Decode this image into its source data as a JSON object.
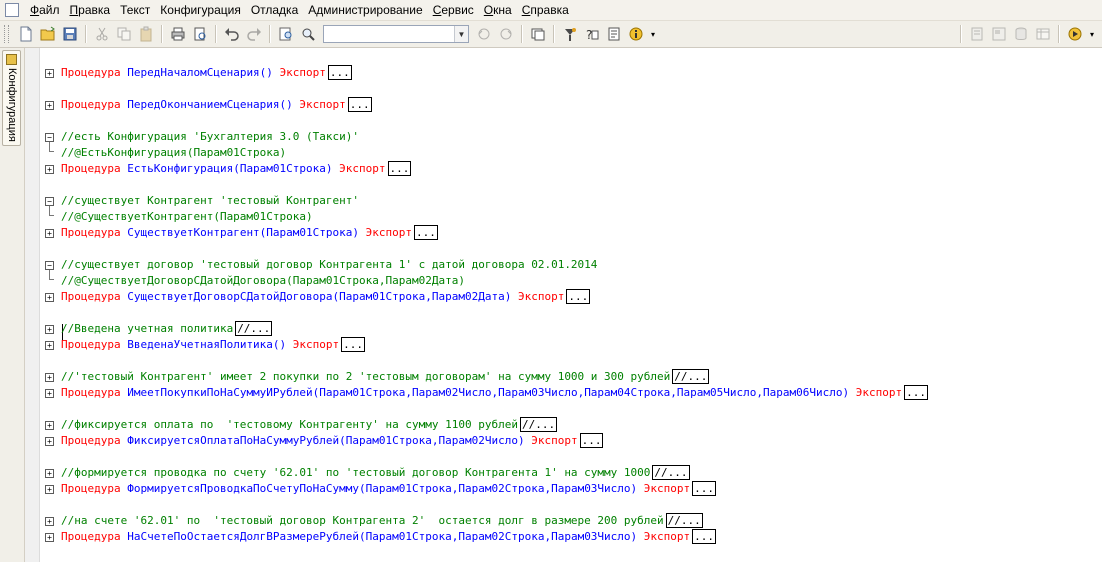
{
  "menu": [
    "Файл",
    "Правка",
    "Текст",
    "Конфигурация",
    "Отладка",
    "Администрирование",
    "Сервис",
    "Окна",
    "Справка"
  ],
  "menu_underline": [
    "Ф",
    "П",
    "",
    "",
    "",
    "",
    "С",
    "О",
    "С"
  ],
  "search": {
    "value": ""
  },
  "sidebar": {
    "tab_label": "Конфигурация"
  },
  "editor": {
    "ellipsis": "...",
    "comment_ellipsis": "//...",
    "lines": [
      {
        "kind": "proc",
        "fold": "plus",
        "keyword": "Процедура",
        "name": "ПередНачаломСценария()",
        "export": "Экспорт"
      },
      {
        "kind": "blank"
      },
      {
        "kind": "proc",
        "fold": "plus",
        "keyword": "Процедура",
        "name": "ПередОкончаниемСценария()",
        "export": "Экспорт"
      },
      {
        "kind": "blank"
      },
      {
        "kind": "comment",
        "fold": "minus",
        "text": "//есть Конфигурация 'Бухгалтерия 3.0 (Такси)'"
      },
      {
        "kind": "comment",
        "fold": "branch",
        "text": "//@ЕстьКонфигурация(Парам01Строка)"
      },
      {
        "kind": "proc",
        "fold": "plus",
        "keyword": "Процедура",
        "name": "ЕстьКонфигурация(Парам01Строка)",
        "export": "Экспорт"
      },
      {
        "kind": "blank"
      },
      {
        "kind": "comment",
        "fold": "minus",
        "text": "//существует Контрагент 'тестовый Контрагент'"
      },
      {
        "kind": "comment",
        "fold": "branch",
        "text": "//@СуществуетКонтрагент(Парам01Строка)"
      },
      {
        "kind": "proc",
        "fold": "plus",
        "keyword": "Процедура",
        "name": "СуществуетКонтрагент(Парам01Строка)",
        "export": "Экспорт"
      },
      {
        "kind": "blank"
      },
      {
        "kind": "comment",
        "fold": "minus",
        "text": "//существует договор 'тестовый договор Контрагента 1' с датой договора 02.01.2014"
      },
      {
        "kind": "comment",
        "fold": "branch",
        "text": "//@СуществуетДоговорСДатойДоговора(Парам01Строка,Парам02Дата)"
      },
      {
        "kind": "proc",
        "fold": "plus",
        "keyword": "Процедура",
        "name": "СуществуетДоговорСДатойДоговора(Парам01Строка,Парам02Дата)",
        "export": "Экспорт"
      },
      {
        "kind": "blank"
      },
      {
        "kind": "comment",
        "fold": "plus",
        "text": "//Введена учетная политика",
        "collapsed": true
      },
      {
        "kind": "proc",
        "fold": "plus",
        "keyword": "Процедура",
        "name": "ВведенаУчетнаяПолитика()",
        "export": "Экспорт"
      },
      {
        "kind": "blank"
      },
      {
        "kind": "comment",
        "fold": "plus",
        "text": "//'тестовый Контрагент' имеет 2 покупки по 2 'тестовым договорам' на сумму 1000 и 300 рублей",
        "collapsed": true
      },
      {
        "kind": "proc",
        "fold": "plus",
        "keyword": "Процедура",
        "name": "ИмеетПокупкиПоНаСуммуИРублей(Парам01Строка,Парам02Число,Парам03Число,Парам04Строка,Парам05Число,Парам06Число)",
        "export": "Экспорт"
      },
      {
        "kind": "blank"
      },
      {
        "kind": "comment",
        "fold": "plus",
        "text": "//фиксируется оплата по  'тестовому Контрагенту' на сумму 1100 рублей",
        "collapsed": true
      },
      {
        "kind": "proc",
        "fold": "plus",
        "keyword": "Процедура",
        "name": "ФиксируетсяОплатаПоНаСуммуРублей(Парам01Строка,Парам02Число)",
        "export": "Экспорт"
      },
      {
        "kind": "blank"
      },
      {
        "kind": "comment",
        "fold": "plus",
        "text": "//формируется проводка по счету '62.01' по 'тестовый договор Контрагента 1' на сумму 1000",
        "collapsed": true
      },
      {
        "kind": "proc",
        "fold": "plus",
        "keyword": "Процедура",
        "name": "ФормируетсяПроводкаПоСчетуПоНаСумму(Парам01Строка,Парам02Строка,Парам03Число)",
        "export": "Экспорт"
      },
      {
        "kind": "blank"
      },
      {
        "kind": "comment",
        "fold": "plus",
        "text": "//на счете '62.01' по  'тестовый договор Контрагента 2'  остается долг в размере 200 рублей",
        "collapsed": true
      },
      {
        "kind": "proc",
        "fold": "plus",
        "keyword": "Процедура",
        "name": "НаСчетеПоОстаетсяДолгВРазмереРублей(Парам01Строка,Парам02Строка,Парам03Число)",
        "export": "Экспорт"
      }
    ]
  },
  "colors": {
    "keyword": "#ff0000",
    "comment": "#008000",
    "identifier": "#0000ff"
  },
  "toolbar_icons": [
    "new-document-icon",
    "open-folder-icon",
    "save-icon",
    "cut-icon",
    "copy-icon",
    "paste-icon",
    "print-icon",
    "print-preview-icon",
    "undo-icon",
    "redo-icon",
    "find-icon",
    "find-next-icon",
    "search-combo",
    "search-back-icon",
    "search-forward-icon",
    "window-icon",
    "debug-icon",
    "syntax-help-icon",
    "properties-icon",
    "info-icon",
    "module-icon",
    "form-icon",
    "database-icon",
    "table-icon",
    "run-icon"
  ]
}
